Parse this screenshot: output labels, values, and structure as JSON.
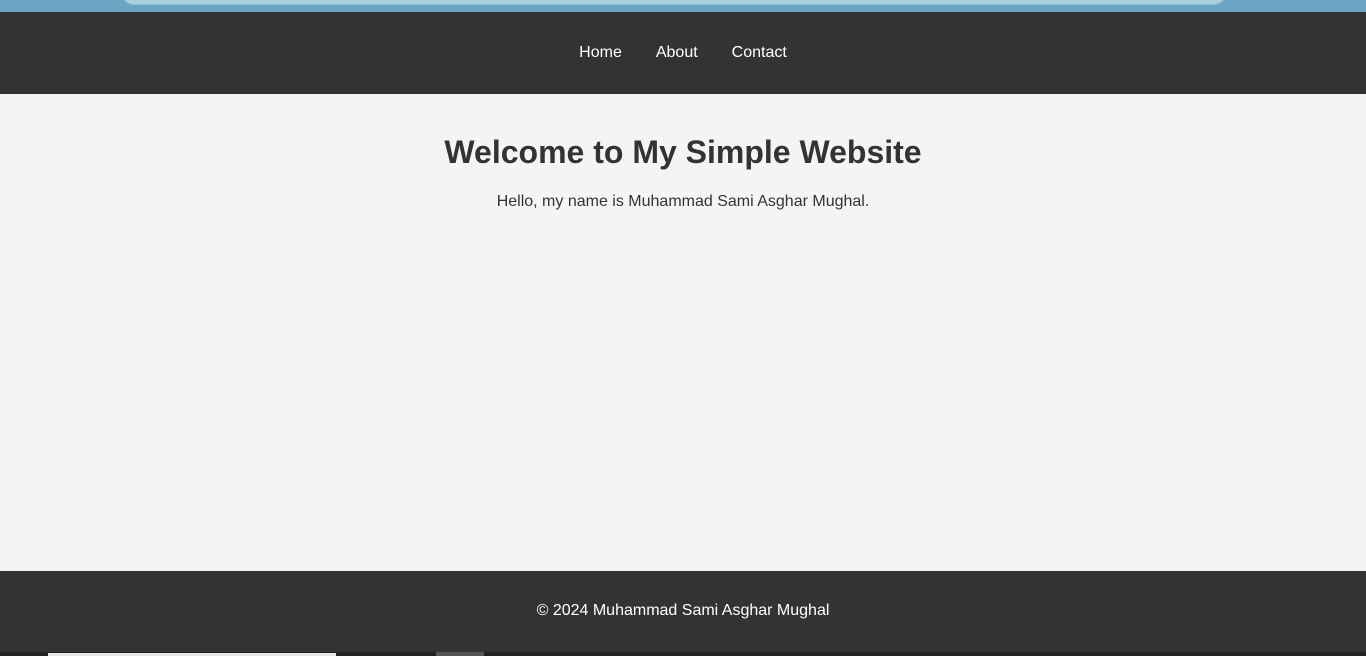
{
  "nav": {
    "items": [
      {
        "label": "Home"
      },
      {
        "label": "About"
      },
      {
        "label": "Contact"
      }
    ]
  },
  "main": {
    "heading": "Welcome to My Simple Website",
    "intro": "Hello, my name is Muhammad Sami Asghar Mughal."
  },
  "footer": {
    "text": "© 2024 Muhammad Sami Asghar Mughal"
  },
  "colors": {
    "header_bg": "#333333",
    "body_bg": "#f4f4f4",
    "text": "#333333",
    "nav_text": "#ffffff"
  }
}
